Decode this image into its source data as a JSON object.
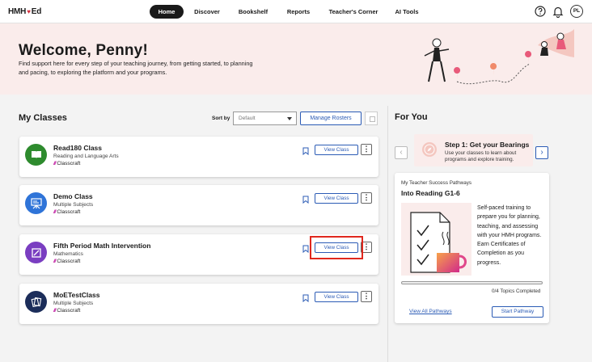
{
  "brand": {
    "logo_prefix": "HMH",
    "logo_heart": "♥",
    "logo_suffix": "Ed"
  },
  "nav": {
    "items": [
      {
        "label": "Home",
        "active": true
      },
      {
        "label": "Discover"
      },
      {
        "label": "Bookshelf"
      },
      {
        "label": "Reports"
      },
      {
        "label": "Teacher's Corner"
      },
      {
        "label": "AI Tools"
      }
    ],
    "help_icon": "help-circle-icon",
    "bell_icon": "bell-icon",
    "avatar_initials": "PL"
  },
  "banner": {
    "title": "Welcome, Penny!",
    "subtitle": "Find support here for every step of your teaching journey, from getting started, to planning and pacing, to exploring the platform and your programs."
  },
  "my_classes": {
    "title": "My Classes",
    "sort_label": "Sort by",
    "sort_value": "Default",
    "manage_rosters": "Manage Rosters",
    "classes": [
      {
        "name": "Read180 Class",
        "subject": "Reading and Language Arts",
        "platform": "Classcraft",
        "view_label": "View Class",
        "icon": "book-icon",
        "icon_color": "#2e8b2e"
      },
      {
        "name": "Demo Class",
        "subject": "Multiple Subjects",
        "platform": "Classcraft",
        "view_label": "View Class",
        "icon": "presentation-board-icon",
        "icon_color": "#2f74d8"
      },
      {
        "name": "Fifth Period Math Intervention",
        "subject": "Mathematics",
        "platform": "Classcraft",
        "view_label": "View Class",
        "icon": "math-icon",
        "icon_color": "#7a3ec1"
      },
      {
        "name": "MoETestClass",
        "subject": "Multiple Subjects",
        "platform": "Classcraft",
        "view_label": "View Class",
        "icon": "cards-icon",
        "icon_color": "#1c2d5a"
      }
    ]
  },
  "for_you": {
    "title": "For You",
    "step_title": "Step 1: Get your Bearings",
    "step_desc": "Use your classes to learn about programs and explore training.",
    "pathway": {
      "label": "My Teacher Success Pathways",
      "title": "Into Reading G1-6",
      "description": "Self-paced training to prepare you for planning, teaching, and assessing with your HMH programs. Earn Certificates of Completion as you progress.",
      "progress": 0,
      "topics_completed": "0/4 Topics Completed",
      "view_all": "View All Pathways",
      "start": "Start Pathway"
    }
  },
  "colors": {
    "accent": "#2b5bb5",
    "banner_bg": "#faeceb",
    "highlight": "#e0281e"
  }
}
